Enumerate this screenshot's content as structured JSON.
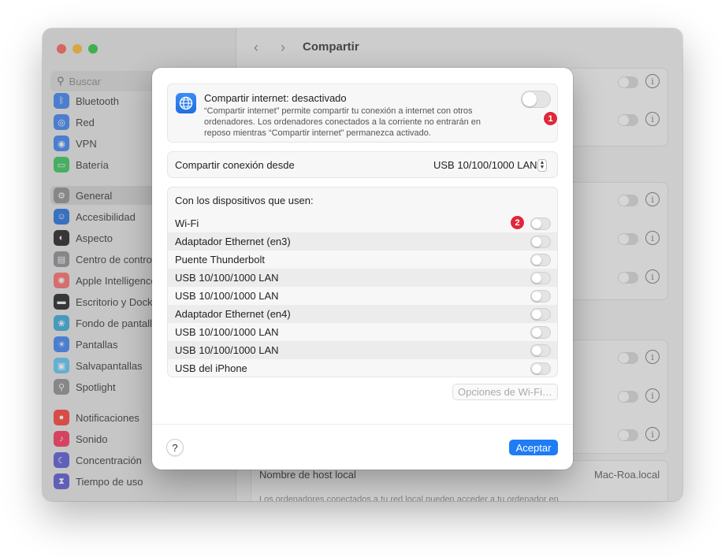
{
  "window": {
    "title": "Compartir"
  },
  "sidebar": {
    "search_placeholder": "Buscar",
    "items": [
      {
        "label": "Bluetooth",
        "icon": "bluetooth-icon",
        "color": "#3a82f6"
      },
      {
        "label": "Red",
        "icon": "globe-icon",
        "color": "#3a82f6"
      },
      {
        "label": "VPN",
        "icon": "vpn-icon",
        "color": "#3a82f6"
      },
      {
        "label": "Batería",
        "icon": "battery-icon",
        "color": "#34c759"
      },
      {
        "label": "General",
        "icon": "gear-icon",
        "color": "#8e8e93",
        "selected": true
      },
      {
        "label": "Accesibilidad",
        "icon": "accessibility-icon",
        "color": "#1e6fe0"
      },
      {
        "label": "Aspecto",
        "icon": "appearance-icon",
        "color": "#1c1c1e"
      },
      {
        "label": "Centro de control",
        "icon": "control-center-icon",
        "color": "#8e8e93"
      },
      {
        "label": "Apple Intelligence",
        "icon": "apple-intelligence-icon",
        "color": "#ff6b6b"
      },
      {
        "label": "Escritorio y Dock",
        "icon": "dock-icon",
        "color": "#1c1c1e"
      },
      {
        "label": "Fondo de pantalla",
        "icon": "wallpaper-icon",
        "color": "#34aadc"
      },
      {
        "label": "Pantallas",
        "icon": "display-icon",
        "color": "#3a82f6"
      },
      {
        "label": "Salvapantallas",
        "icon": "screensaver-icon",
        "color": "#5ac8fa"
      },
      {
        "label": "Spotlight",
        "icon": "spotlight-icon",
        "color": "#8e8e93"
      },
      {
        "label": "Notificaciones",
        "icon": "notifications-icon",
        "color": "#ff3b30"
      },
      {
        "label": "Sonido",
        "icon": "sound-icon",
        "color": "#ff2d55"
      },
      {
        "label": "Concentración",
        "icon": "focus-icon",
        "color": "#5856d6"
      },
      {
        "label": "Tiempo de uso",
        "icon": "screen-time-icon",
        "color": "#5856d6"
      }
    ]
  },
  "background": {
    "host_label": "Nombre de host local",
    "host_value": "Mac-Roa.local",
    "host_desc": "Los ordenadores conectados a tu red local pueden acceder a tu ordenador en"
  },
  "sheet": {
    "internet_sharing": {
      "title": "Compartir internet: desactivado",
      "description": "“Compartir internet” permite compartir tu conexión a internet con otros ordenadores. Los ordenadores conectados a la corriente no entrarán en reposo mientras “Compartir internet” permanezca activado.",
      "enabled": false,
      "badge": "1"
    },
    "share_from": {
      "label": "Compartir conexión desde",
      "value": "USB 10/100/1000 LAN"
    },
    "devices": {
      "header": "Con los dispositivos que usen:",
      "badge": "2",
      "items": [
        {
          "label": "Wi-Fi",
          "enabled": false
        },
        {
          "label": "Adaptador Ethernet (en3)",
          "enabled": false
        },
        {
          "label": "Puente Thunderbolt",
          "enabled": false
        },
        {
          "label": "USB 10/100/1000 LAN",
          "enabled": false
        },
        {
          "label": "USB 10/100/1000 LAN",
          "enabled": false
        },
        {
          "label": "Adaptador Ethernet (en4)",
          "enabled": false
        },
        {
          "label": "USB 10/100/1000 LAN",
          "enabled": false
        },
        {
          "label": "USB 10/100/1000 LAN",
          "enabled": false
        },
        {
          "label": "USB del iPhone",
          "enabled": false
        }
      ]
    },
    "wifi_options_label": "Opciones de Wi-Fi…",
    "help_label": "?",
    "ok_label": "Aceptar"
  },
  "colors": {
    "accent": "#1f7cf5",
    "badge": "#e0283a"
  }
}
